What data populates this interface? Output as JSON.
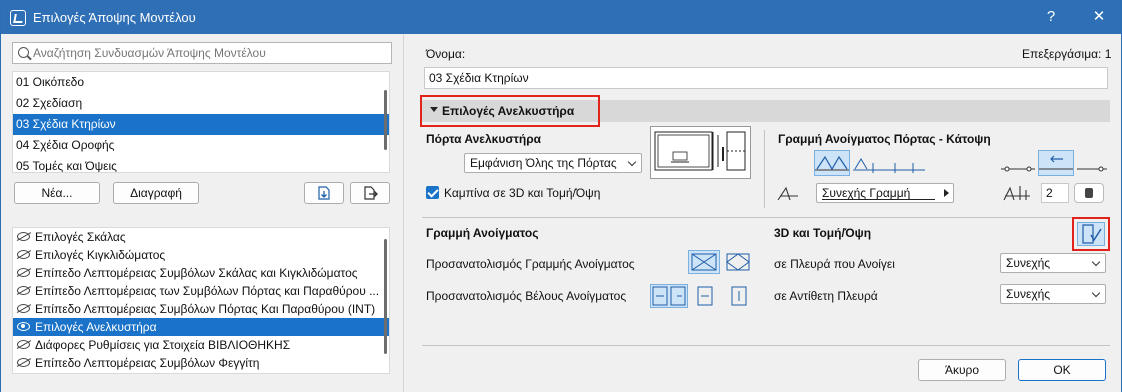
{
  "window": {
    "title": "Επιλογές Άποψης Μοντέλου",
    "help": "?",
    "close": "✕"
  },
  "left": {
    "search": {
      "placeholder": "Αναζήτηση Συνδυασμών Άποψης Μοντέλου"
    },
    "combinations": [
      {
        "label": "01 Οικόπεδο",
        "selected": false
      },
      {
        "label": "02 Σχεδίαση",
        "selected": false
      },
      {
        "label": "03 Σχέδια Κτηρίων",
        "selected": true
      },
      {
        "label": "04 Σχέδια Οροφής",
        "selected": false
      },
      {
        "label": "05 Τομές και Όψεις",
        "selected": false
      }
    ],
    "new_label": "Νέα...",
    "delete_label": "Διαγραφή",
    "options": [
      {
        "label": "Επιλογές Σκάλας",
        "selected": false
      },
      {
        "label": "Επιλογές Κιγκλιδώματος",
        "selected": false
      },
      {
        "label": "Επίπεδο Λεπτομέρειας Συμβόλων Σκάλας και Κιγκλιδώματος",
        "selected": false
      },
      {
        "label": "Επίπεδο Λεπτομέρειας των Συμβόλων Πόρτας και Παραθύρου ...",
        "selected": false
      },
      {
        "label": "Επίπεδο Λεπτομέρειας Συμβόλων Πόρτας Και Παραθύρου (INT)",
        "selected": false
      },
      {
        "label": "Επιλογές Ανελκυστήρα",
        "selected": true
      },
      {
        "label": "Διάφορες Ρυθμίσεις για Στοιχεία ΒΙΒΛΙΟΘΗΚΗΣ",
        "selected": false
      },
      {
        "label": "Επίπεδο Λεπτομέρειας Συμβόλων Φεγγίτη",
        "selected": false
      }
    ]
  },
  "right": {
    "name_label": "Όνομα:",
    "edit_status": "Επεξεργάσιμα: 1",
    "name_value": "03 Σχέδια Κτηρίων",
    "section_title": "Επιλογές Ανελκυστήρα",
    "elevator_door": {
      "heading": "Πόρτα Ανελκυστήρα",
      "dropdown_value": "Εμφάνιση Όλης της Πόρτας",
      "checkbox_label": "Καμπίνα σε 3D και Τομή/Όψη",
      "checkbox_checked": true
    },
    "door_opening_line": {
      "heading": "Γραμμή Ανοίγματος Πόρτας - Κάτοψη",
      "line_type": "Συνεχής Γραμμή",
      "pen_value": "2"
    },
    "opening_line": {
      "heading": "Γραμμή Ανοίγματος",
      "orientation_label": "Προσανατολισμός Γραμμής Ανοίγματος",
      "arrow_label": "Προσανατολισμός Βέλους Ανοίγματος"
    },
    "section_3d": {
      "heading": "3D και Τομή/Όψη",
      "open_side_label": "σε Πλευρά που Ανοίγει",
      "open_side_value": "Συνεχής",
      "opposite_side_label": "σε Αντίθετη Πλευρά",
      "opposite_side_value": "Συνεχής"
    },
    "cancel_label": "Άκυρο",
    "ok_label": "OK"
  },
  "colors": {
    "titlebar": "#2f6fb5",
    "selection": "#1a73c9",
    "highlight_box": "#e2231a"
  }
}
